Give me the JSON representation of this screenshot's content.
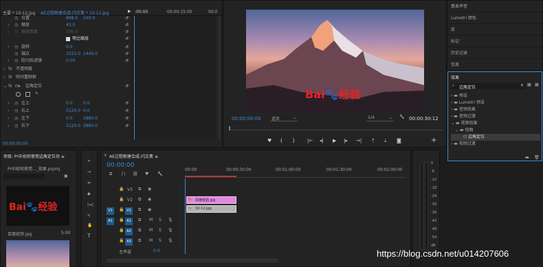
{
  "effect_controls": {
    "header_source": "主要 * 10-12.jpg",
    "header_seq": "AE过程新建合成-闪文素 * 10-12.jpg",
    "ruler_start": ":00:00",
    "ruler_mid": "00:00:15:00",
    "ruler_end": "00:0",
    "rows": [
      {
        "label": "位置",
        "v1": "898.0",
        "v2": "540.0"
      },
      {
        "label": "缩放",
        "v1": "43.0",
        "v2": ""
      },
      {
        "label": "缩放宽度",
        "v1": "100.0",
        "v2": ""
      },
      {
        "label": "等比缩放",
        "v1": "",
        "v2": ""
      },
      {
        "label": "旋转",
        "v1": "0.0",
        "v2": ""
      },
      {
        "label": "锚点",
        "v1": "2523.0",
        "v2": "1440.0"
      },
      {
        "label": "防闪烁滤镜",
        "v1": "0.00",
        "v2": ""
      },
      {
        "label": "不透明度",
        "v1": "",
        "v2": ""
      },
      {
        "label": "时间重映射",
        "v1": "",
        "v2": ""
      },
      {
        "label": "边角定位",
        "v1": "",
        "v2": ""
      },
      {
        "label": "左上",
        "v1": "0.0",
        "v2": "0.0"
      },
      {
        "label": "右上",
        "v1": "5120.0",
        "v2": "0.0"
      },
      {
        "label": "左下",
        "v1": "0.0",
        "v2": "2880.0"
      },
      {
        "label": "右下",
        "v1": "5120.0",
        "v2": "2880.0"
      }
    ],
    "timecode": "00:00:00:00"
  },
  "program": {
    "timecode": "00:00:00:00",
    "fit": "适合",
    "quality": "1/4",
    "duration": "00:00:30:12",
    "baidu_text": "Bai",
    "baidu_text2": "经验"
  },
  "right_panel": {
    "items": [
      "基本声音",
      "Lumetri 颜色",
      "库",
      "标记",
      "历史记录",
      "信息"
    ],
    "effects_title": "效果",
    "search_value": "边角定位",
    "tree": [
      "预设",
      "Lumetri 预设",
      "音频效果",
      "音频过渡",
      "视频效果",
      "扭曲",
      "边角定位",
      "视频过渡"
    ]
  },
  "project": {
    "title": "项目: Pr中如何使用边角定位功 ≡",
    "file": "Pr中如何使用..._效果.prproj",
    "clip_name": "百度经验.jpg",
    "clip_dur": "5:00"
  },
  "timeline": {
    "title": "AE过程新建合成-闪文素 ≡",
    "timecode": "00:00:00",
    "ruler": [
      "00:00",
      "00:00:30:00",
      "00:01:00:00",
      "00:01:30:00",
      "00:02:00:00"
    ],
    "tracks": [
      "V3",
      "V2",
      "V1",
      "A1",
      "A2",
      "A3"
    ],
    "master": "主声道",
    "master_val": "0.0",
    "clip1": "百度经验.jpg",
    "clip2": "10-12.jpg"
  },
  "meter": {
    "labels": [
      "0",
      "-6",
      "-12",
      "-18",
      "-24",
      "-30",
      "-36",
      "-42",
      "-48",
      "-54",
      "dB"
    ]
  },
  "watermark": "https://blog.csdn.net/u014207606"
}
